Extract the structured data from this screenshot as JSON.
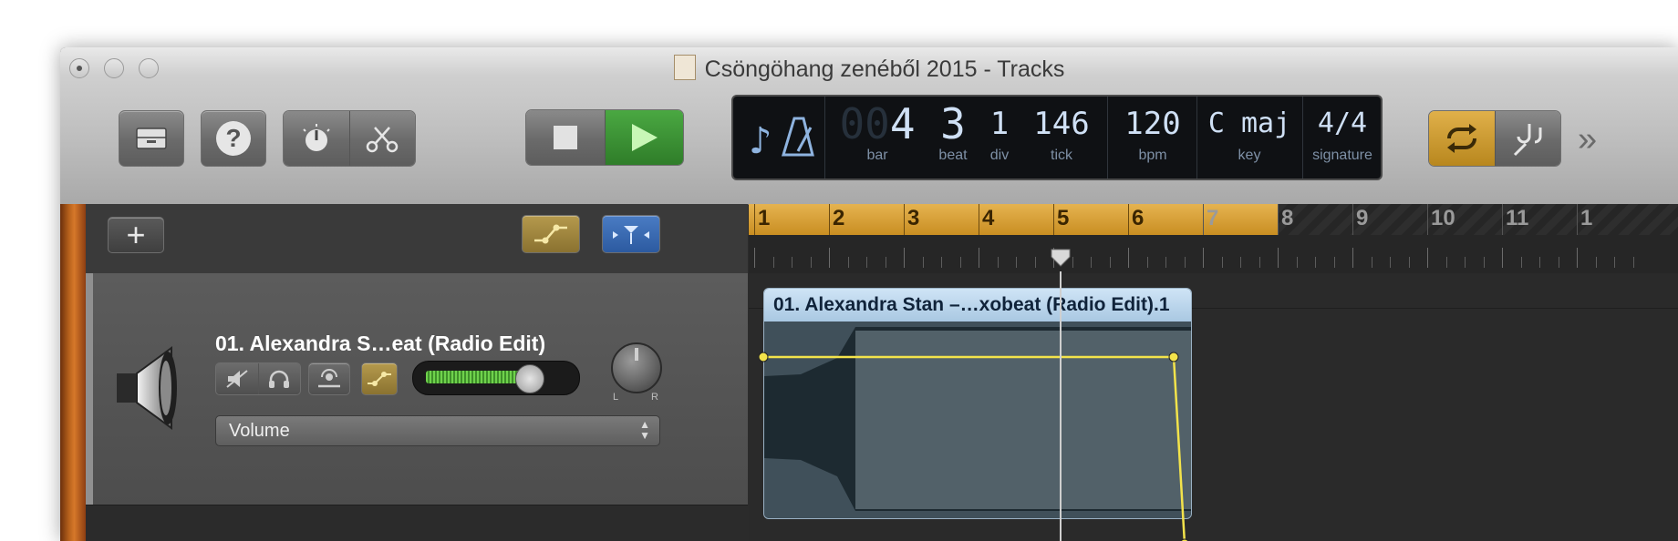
{
  "window": {
    "title": "Csöngöhang zenéből 2015 - Tracks"
  },
  "toolbar": {
    "library_icon": "library-tray-icon",
    "help_label": "?",
    "smart_controls_icon": "knob-icon",
    "editors_icon": "scissors-icon",
    "stop_icon": "stop-icon",
    "play_icon": "play-icon",
    "cycle_icon": "cycle-icon",
    "tuner_icon": "tuning-fork-icon",
    "more_label": "»"
  },
  "lcd": {
    "bar_dim": "00",
    "bar": "4",
    "beat": "3",
    "div": "1",
    "tick": "146",
    "bpm": "120",
    "key": "C maj",
    "signature": "4/4",
    "captions": {
      "bar": "bar",
      "beat": "beat",
      "div": "div",
      "tick": "tick",
      "bpm": "bpm",
      "key": "key",
      "signature": "signature"
    }
  },
  "tracks_header": {
    "add_label": "+"
  },
  "track": {
    "name": "01. Alexandra S…eat (Radio Edit)",
    "automation_param": "Volume",
    "pan_left": "L",
    "pan_right": "R",
    "volume_level": 0.78
  },
  "ruler": {
    "bars": [
      "1",
      "2",
      "3",
      "4",
      "5",
      "6",
      "7",
      "8",
      "9",
      "10",
      "11",
      "1"
    ]
  },
  "region": {
    "name": "01. Alexandra Stan –…xobeat (Radio Edit).1"
  },
  "colors": {
    "cycle": "#d9a53a",
    "region_header": "#bcd7ee",
    "automation": "#f3e34b",
    "play": "#3b9b35"
  }
}
